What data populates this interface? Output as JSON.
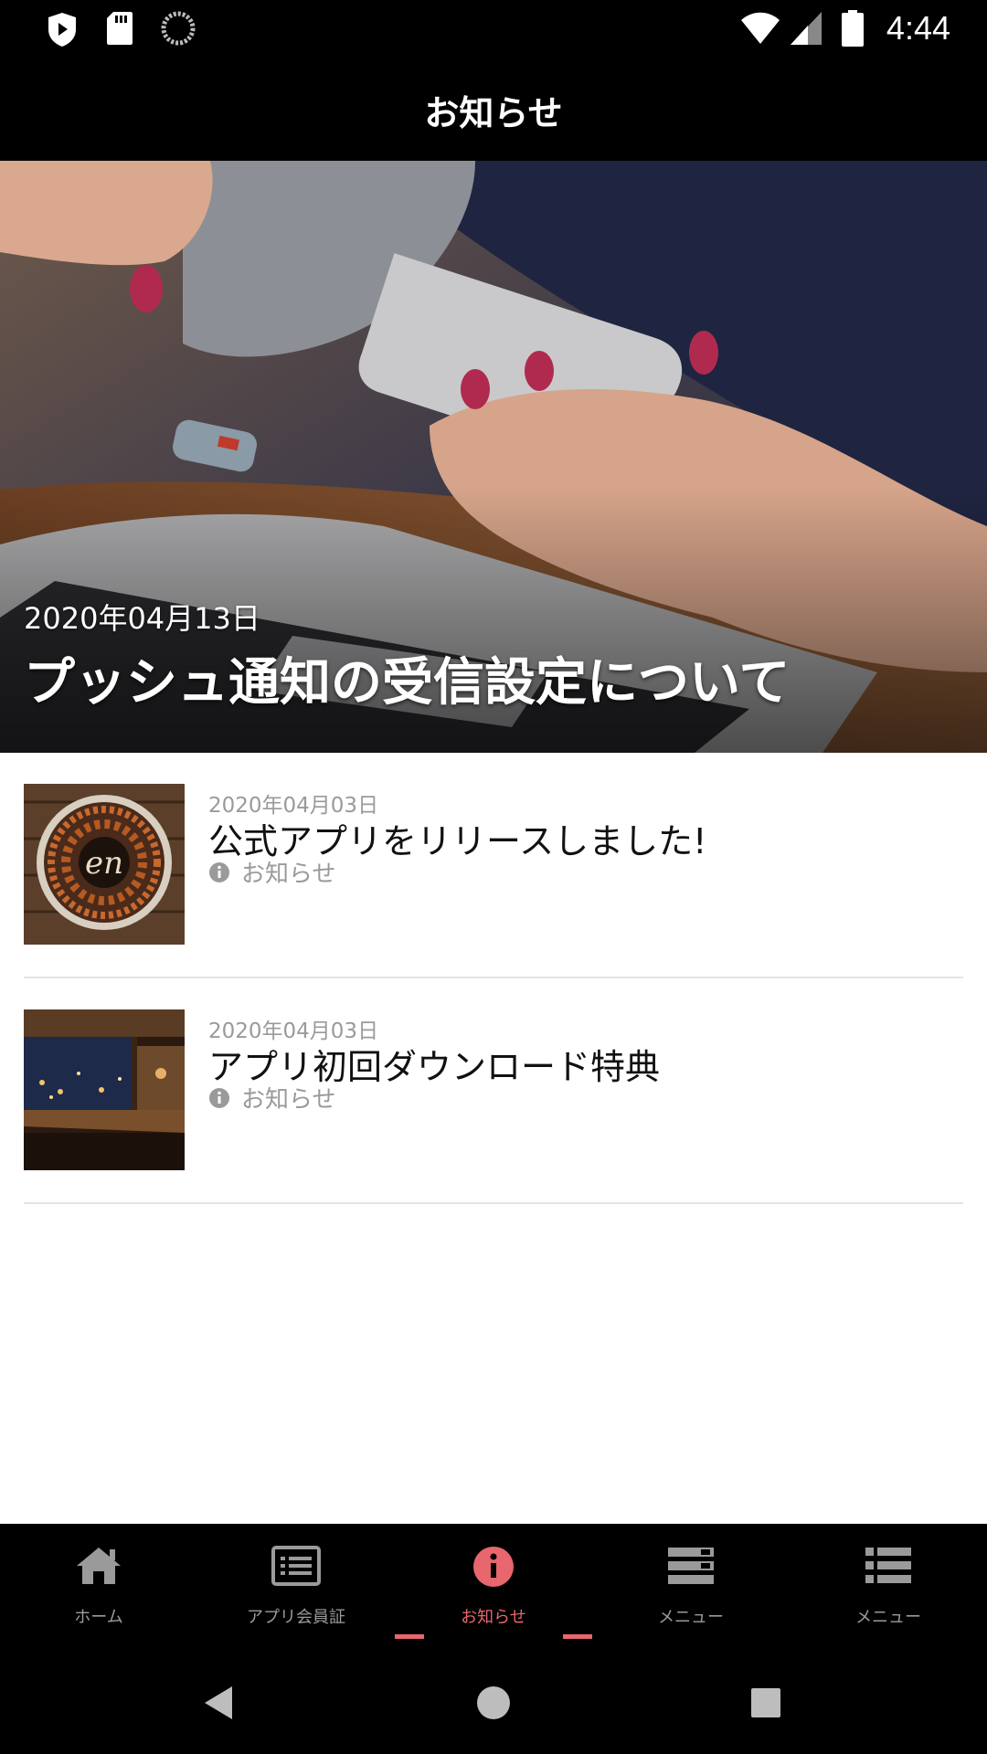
{
  "status_bar": {
    "time": "4:44",
    "icons": [
      "shield-icon",
      "sd-card-icon",
      "sync-icon",
      "wifi-icon",
      "signal-icon",
      "battery-icon"
    ]
  },
  "header": {
    "title": "お知らせ"
  },
  "hero": {
    "date": "2020年04月13日",
    "title": "プッシュ通知の受信設定について"
  },
  "news": [
    {
      "date": "2020年04月03日",
      "title": "公式アプリをリリースしました!",
      "category": "お知らせ",
      "category_icon": "info-icon"
    },
    {
      "date": "2020年04月03日",
      "title": "アプリ初回ダウンロード特典",
      "category": "お知らせ",
      "category_icon": "info-icon"
    }
  ],
  "bottom_nav": {
    "active_index": 2,
    "active_color": "#e8666e",
    "items": [
      {
        "label": "ホーム",
        "icon": "home-icon"
      },
      {
        "label": "アプリ会員証",
        "icon": "member-card-icon"
      },
      {
        "label": "お知らせ",
        "icon": "info-icon"
      },
      {
        "label": "メニュー",
        "icon": "menu-list-icon"
      },
      {
        "label": "メニュー",
        "icon": "list-icon"
      }
    ]
  },
  "system_nav": {
    "icons": [
      "back-icon",
      "home-circle-icon",
      "recents-icon"
    ]
  }
}
